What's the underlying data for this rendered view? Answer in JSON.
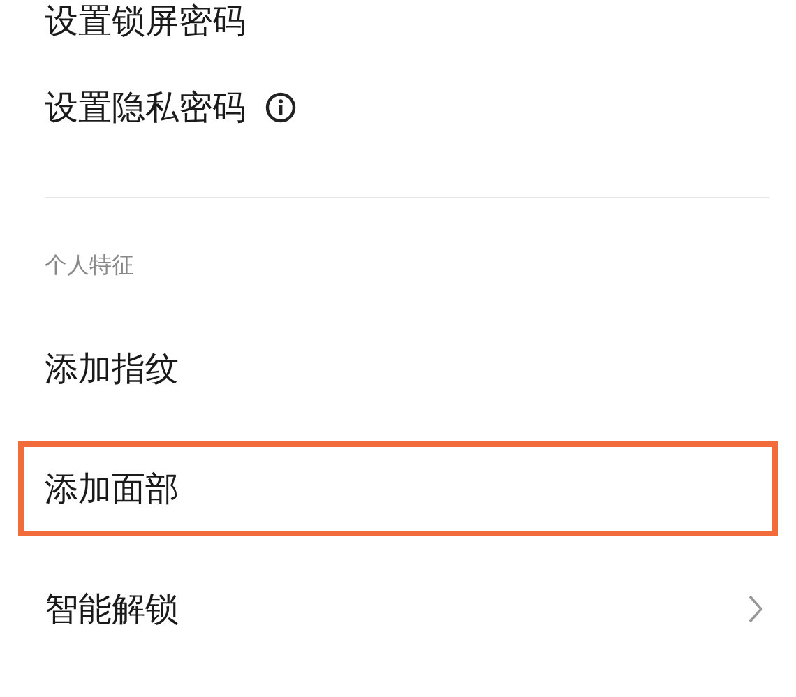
{
  "groups": [
    {
      "items": [
        {
          "label": "设置锁屏密码",
          "kind": "plain",
          "highlighted": false
        },
        {
          "label": "设置隐私密码",
          "kind": "info",
          "highlighted": false
        }
      ]
    },
    {
      "header": "个人特征",
      "items": [
        {
          "label": "添加指纹",
          "kind": "plain",
          "highlighted": false
        },
        {
          "label": "添加面部",
          "kind": "plain",
          "highlighted": true
        },
        {
          "label": "智能解锁",
          "kind": "chevron",
          "highlighted": false
        }
      ]
    }
  ]
}
